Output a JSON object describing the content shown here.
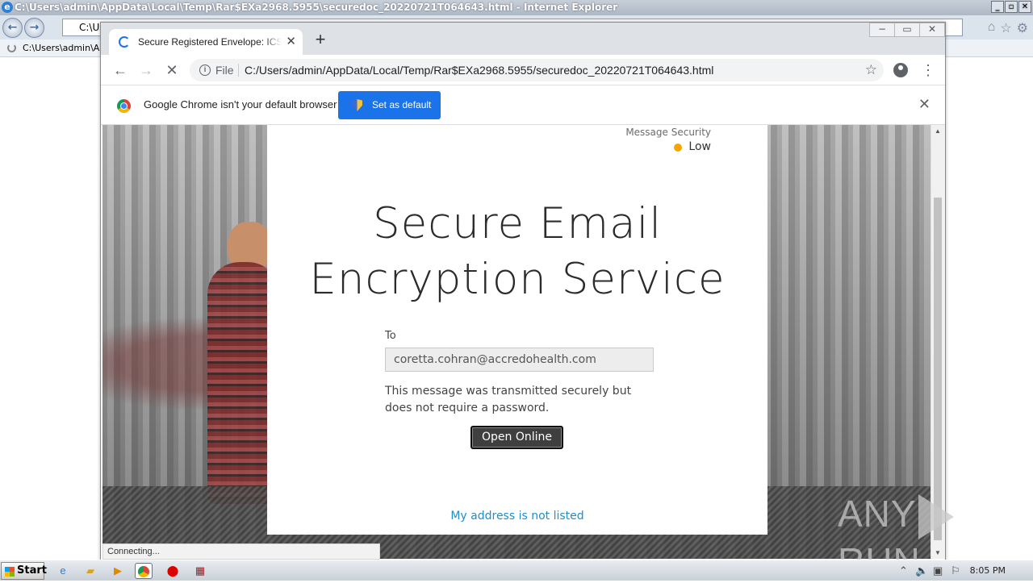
{
  "ie": {
    "window_title": "C:\\Users\\admin\\AppData\\Local\\Temp\\Rar$EXa2968.5955\\securedoc_20220721T064643.html - Internet Explorer",
    "address": "C:\\Us",
    "tab_label": "C:\\Users\\admin\\App"
  },
  "chrome": {
    "tab_title": "Secure Registered Envelope: ICSR I",
    "file_label": "File",
    "url": "C:/Users/admin/AppData/Local/Temp/Rar$EXa2968.5955/securedoc_20220721T064643.html",
    "infobar_message": "Google Chrome isn't your default browser",
    "set_default_label": "Set as default",
    "status_text": "Connecting..."
  },
  "page": {
    "security_label": "Message Security",
    "security_level": "Low",
    "security_color": "#f5a400",
    "headline_line1": "Secure Email",
    "headline_line2": "Encryption Service",
    "to_label": "To",
    "to_value": "coretta.cohran@accredohealth.com",
    "note": "This message was transmitted securely but does not require a password.",
    "open_button": "Open Online",
    "not_listed_link": "My address is not listed"
  },
  "watermark": {
    "left": "ANY",
    "right": "RUN"
  },
  "taskbar": {
    "start_label": "Start",
    "clock": "8:05 PM"
  }
}
